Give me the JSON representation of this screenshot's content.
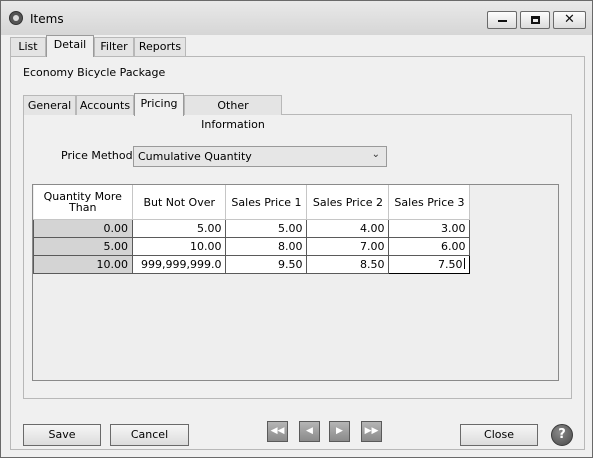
{
  "window": {
    "title": "Items"
  },
  "top_tabs": [
    "List",
    "Detail",
    "Filter",
    "Reports"
  ],
  "item_name": "Economy Bicycle Package",
  "sub_tabs": [
    "General",
    "Accounts",
    "Pricing",
    "Other Information"
  ],
  "price_method": {
    "label": "Price Method",
    "value": "Cumulative Quantity"
  },
  "grid": {
    "headers": [
      "Quantity More Than",
      "But Not Over",
      "Sales Price 1",
      "Sales Price 2",
      "Sales Price 3"
    ],
    "rows": [
      [
        "0.00",
        "5.00",
        "5.00",
        "4.00",
        "3.00"
      ],
      [
        "5.00",
        "10.00",
        "8.00",
        "7.00",
        "6.00"
      ],
      [
        "10.00",
        "999,999,999.0",
        "9.50",
        "8.50",
        "7.50"
      ]
    ]
  },
  "buttons": {
    "save": "Save",
    "cancel": "Cancel",
    "close": "Close",
    "help": "?"
  },
  "icons": [
    "app-icon",
    "minimize-icon",
    "maximize-icon",
    "close-icon",
    "first-record-icon",
    "previous-record-icon",
    "next-record-icon",
    "last-record-icon",
    "help-icon",
    "dropdown-chevron-icon"
  ]
}
